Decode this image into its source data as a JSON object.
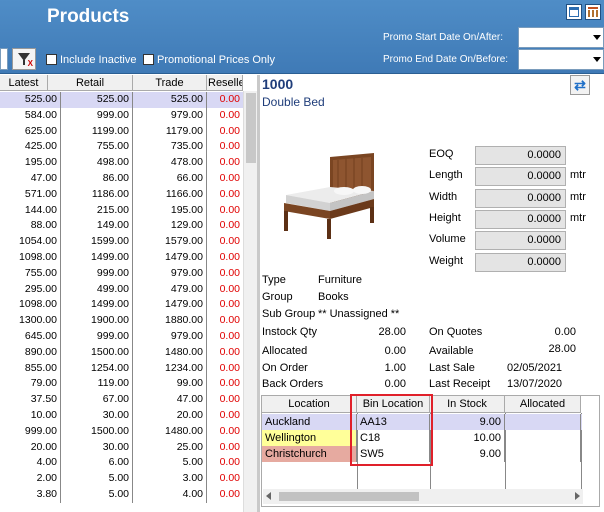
{
  "header": {
    "title": "Products",
    "promo_start_label": "Promo Start Date On/After:",
    "promo_end_label": "Promo End Date On/Before:",
    "promo_start_value": "",
    "promo_end_value": "",
    "include_inactive_label": "Include Inactive",
    "promotional_only_label": "Promotional Prices Only",
    "filter_mark": "X"
  },
  "price_grid": {
    "columns": [
      "Latest",
      "Retail",
      "Trade",
      "Reseller"
    ],
    "rows": [
      [
        "525.00",
        "525.00",
        "525.00",
        "0.00"
      ],
      [
        "584.00",
        "999.00",
        "979.00",
        "0.00"
      ],
      [
        "625.00",
        "1199.00",
        "1179.00",
        "0.00"
      ],
      [
        "425.00",
        "755.00",
        "735.00",
        "0.00"
      ],
      [
        "195.00",
        "498.00",
        "478.00",
        "0.00"
      ],
      [
        "47.00",
        "86.00",
        "66.00",
        "0.00"
      ],
      [
        "571.00",
        "1186.00",
        "1166.00",
        "0.00"
      ],
      [
        "144.00",
        "215.00",
        "195.00",
        "0.00"
      ],
      [
        "88.00",
        "149.00",
        "129.00",
        "0.00"
      ],
      [
        "1054.00",
        "1599.00",
        "1579.00",
        "0.00"
      ],
      [
        "1098.00",
        "1499.00",
        "1479.00",
        "0.00"
      ],
      [
        "755.00",
        "999.00",
        "979.00",
        "0.00"
      ],
      [
        "295.00",
        "499.00",
        "479.00",
        "0.00"
      ],
      [
        "1098.00",
        "1499.00",
        "1479.00",
        "0.00"
      ],
      [
        "1300.00",
        "1900.00",
        "1880.00",
        "0.00"
      ],
      [
        "645.00",
        "999.00",
        "979.00",
        "0.00"
      ],
      [
        "890.00",
        "1500.00",
        "1480.00",
        "0.00"
      ],
      [
        "855.00",
        "1254.00",
        "1234.00",
        "0.00"
      ],
      [
        "79.00",
        "119.00",
        "99.00",
        "0.00"
      ],
      [
        "37.50",
        "67.00",
        "47.00",
        "0.00"
      ],
      [
        "10.00",
        "30.00",
        "20.00",
        "0.00"
      ],
      [
        "999.00",
        "1500.00",
        "1480.00",
        "0.00"
      ],
      [
        "20.00",
        "30.00",
        "25.00",
        "0.00"
      ],
      [
        "4.00",
        "6.00",
        "5.00",
        "0.00"
      ],
      [
        "2.00",
        "5.00",
        "3.00",
        "0.00"
      ],
      [
        "3.80",
        "5.00",
        "4.00",
        "0.00"
      ]
    ]
  },
  "product": {
    "code": "1000",
    "name": "Double Bed",
    "dimensions": [
      {
        "label": "EOQ",
        "value": "0.0000",
        "unit": ""
      },
      {
        "label": "Length",
        "value": "0.0000",
        "unit": "mtr"
      },
      {
        "label": "Width",
        "value": "0.0000",
        "unit": "mtr"
      },
      {
        "label": "Height",
        "value": "0.0000",
        "unit": "mtr"
      },
      {
        "label": "Volume",
        "value": "0.0000",
        "unit": ""
      },
      {
        "label": "Weight",
        "value": "0.0000",
        "unit": ""
      }
    ],
    "type_label": "Type",
    "type_value": "Furniture",
    "group_label": "Group",
    "group_value": "Books",
    "subgroup_label": "Sub Group",
    "subgroup_value": "** Unassigned **",
    "instock_label": "Instock Qty",
    "instock_value": "28.00",
    "allocated_label": "Allocated",
    "allocated_value": "0.00",
    "onorder_label": "On Order",
    "onorder_value": "1.00",
    "backorders_label": "Back Orders",
    "backorders_value": "0.00",
    "onquotes_label": "On Quotes",
    "onquotes_value": "0.00",
    "available_label": "Available",
    "available_value": "28.00",
    "lastsale_label": "Last Sale",
    "lastsale_value": "02/05/2021",
    "lastreceipt_label": "Last Receipt",
    "lastreceipt_value": "13/07/2020"
  },
  "stock_grid": {
    "columns": [
      "Location",
      "Bin Location",
      "In Stock",
      "Allocated"
    ],
    "rows": [
      {
        "location": "Auckland",
        "bin": "AA13",
        "instock": "9.00",
        "allocated": "",
        "color": "#d8d8f4"
      },
      {
        "location": "Wellington",
        "bin": "C18",
        "instock": "10.00",
        "allocated": "",
        "color": "#ffff99"
      },
      {
        "location": "Christchurch",
        "bin": "SW5",
        "instock": "9.00",
        "allocated": "",
        "color": "#e6aaa0"
      }
    ]
  },
  "colors": {
    "header": "#4f8dc7",
    "selected_row": "#d8d8f4",
    "reseller_text": "#e00000",
    "highlight_box": "#e0202a",
    "product_title": "#1f3d7a"
  }
}
